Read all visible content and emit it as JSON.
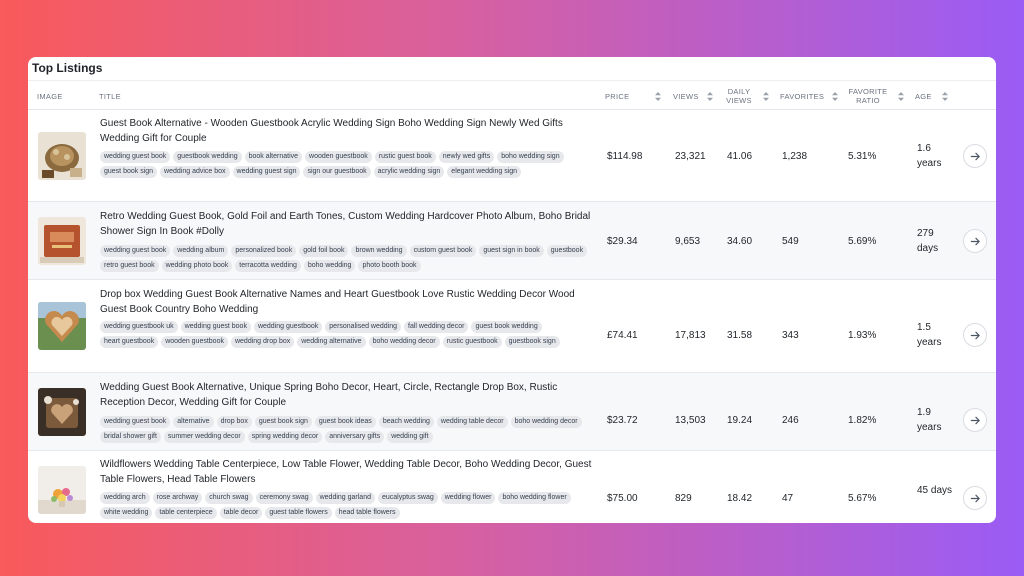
{
  "card": {
    "title": "Top Listings"
  },
  "columns": {
    "image": "IMAGE",
    "title": "TITLE",
    "price": "PRICE",
    "views": "VIEWS",
    "daily_views": "DAILY VIEWS",
    "favorites": "FAVORITES",
    "favorite_ratio": "FAVORITE RATIO",
    "age": "AGE"
  },
  "icons": {
    "sort": "sort-up-down-icon",
    "open": "arrow-right-icon"
  },
  "colors": {
    "bg_left": "#f95a5a",
    "bg_right": "#9a5cf5",
    "tag_bg": "#e7e8eb",
    "row_alt": "#f7f8fa"
  },
  "listings": [
    {
      "title": "Guest Book Alternative - Wooden Guestbook Acrylic Wedding Sign Boho Wedding Sign Newly Wed Gifts Wedding Gift for Couple",
      "tags": [
        "wedding guest book",
        "guestbook wedding",
        "book alternative",
        "wooden guestbook",
        "rustic guest book",
        "newly wed gifts",
        "boho wedding sign",
        "guest book sign",
        "wedding advice box",
        "wedding guest sign",
        "sign our guestbook",
        "acrylic wedding sign",
        "elegant wedding sign"
      ],
      "price": "$114.98",
      "views": "23,321",
      "daily_views": "41.06",
      "favorites": "1,238",
      "favorite_ratio": "5.31%",
      "age": "1.6 years"
    },
    {
      "title": "Retro Wedding Guest Book, Gold Foil and Earth Tones, Custom Wedding Hardcover Photo Album, Boho Bridal Shower Sign In Book #Dolly",
      "tags": [
        "wedding guest book",
        "wedding album",
        "personalized book",
        "gold foil book",
        "brown wedding",
        "custom guest book",
        "guest sign in book",
        "guestbook",
        "retro guest book",
        "wedding photo book",
        "terracotta wedding",
        "boho wedding",
        "photo booth book"
      ],
      "price": "$29.34",
      "views": "9,653",
      "daily_views": "34.60",
      "favorites": "549",
      "favorite_ratio": "5.69%",
      "age": "279 days"
    },
    {
      "title": "Drop box Wedding Guest Book Alternative Names and Heart Guestbook Love Rustic Wedding Decor Wood Guest Book Country Boho Wedding",
      "tags": [
        "wedding guestbook uk",
        "wedding guest book",
        "wedding guestbook",
        "personalised wedding",
        "fall wedding decor",
        "guest book wedding",
        "heart guestbook",
        "wooden guestbook",
        "wedding drop box",
        "wedding alternative",
        "boho wedding decor",
        "rustic guestbook",
        "guestbook sign"
      ],
      "price": "£74.41",
      "views": "17,813",
      "daily_views": "31.58",
      "favorites": "343",
      "favorite_ratio": "1.93%",
      "age": "1.5 years"
    },
    {
      "title": "Wedding Guest Book Alternative, Unique Spring Boho Decor, Heart, Circle, Rectangle Drop Box, Rustic Reception Decor, Wedding Gift for Couple",
      "tags": [
        "wedding guest book",
        "alternative",
        "drop box",
        "guest book sign",
        "guest book ideas",
        "beach wedding",
        "wedding table decor",
        "boho wedding decor",
        "bridal shower gift",
        "summer wedding decor",
        "spring wedding decor",
        "anniversary gifts",
        "wedding gift"
      ],
      "price": "$23.72",
      "views": "13,503",
      "daily_views": "19.24",
      "favorites": "246",
      "favorite_ratio": "1.82%",
      "age": "1.9 years"
    },
    {
      "title": "Wildflowers Wedding Table Centerpiece, Low Table Flower, Wedding Table Decor, Boho Wedding Decor, Guest Table Flowers, Head Table Flowers",
      "tags": [
        "wedding arch",
        "rose archway",
        "church swag",
        "ceremony swag",
        "wedding garland",
        "eucalyptus swag",
        "wedding flower",
        "boho wedding flower",
        "white wedding",
        "table centerpiece",
        "table decor",
        "guest table flowers",
        "head table flowers"
      ],
      "price": "$75.00",
      "views": "829",
      "daily_views": "18.42",
      "favorites": "47",
      "favorite_ratio": "5.67%",
      "age": "45 days"
    }
  ]
}
